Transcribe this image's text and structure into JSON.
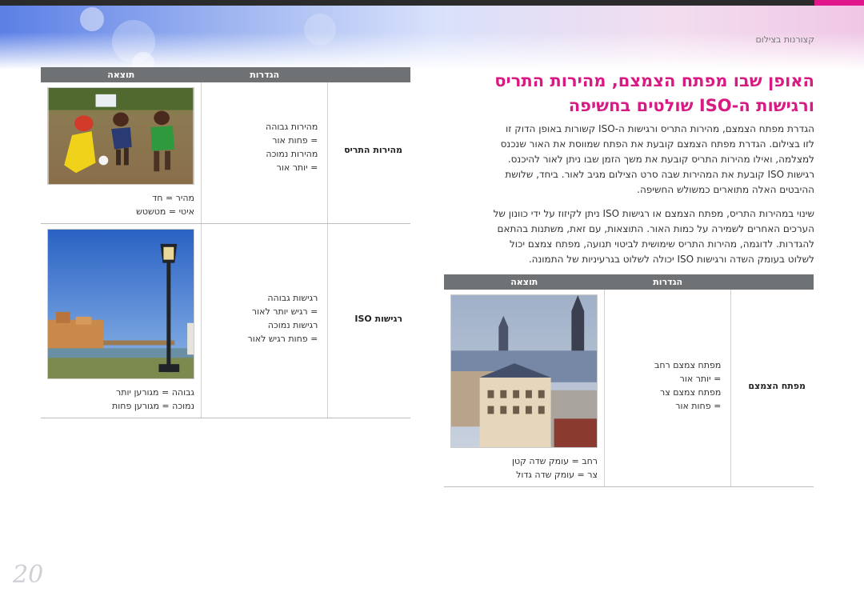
{
  "breadcrumb": "קצורנות בצילום",
  "title_line1": "האופן שבו מפתח הצמצם, מהירות התריס",
  "title_line2": "ורגישות ה-ISO שולטים בחשיפה",
  "paragraph1": [
    "הגדרת מפתח הצמצם, מהירות התריס ורגישות ה-ISO קשורות באופן הדוק זו",
    "לזו בצילום. הגדרת מפתח הצמצם קובעת את הפתח שמווסת את האור שנכנס",
    "למצלמה, ואילו מהירות התריס קובעת את משך הזמן שבו ניתן לאור להיכנס.",
    "רגישות ISO קובעת את המהירות שבה סרט הצילום מגיב לאור. ביחד, שלושת",
    "ההיבטים האלה מתוארים כמשולש החשיפה."
  ],
  "paragraph2": [
    "שינוי במהירות התריס, מפתח הצמצם או רגישות ISO ניתן לקיזוז על ידי כוונון של",
    "הערכים האחרים לשמירה על כמות האור. התוצאות, עם זאת, משתנות בהתאם",
    "להגדרות. לדוגמה, מהירות התריס שימושית לביטוי תנועה, מפתח צמצם יכול",
    "לשלוט בעומק השדה ורגישות ISO יכולה לשלוט בגרעיניות של התמונה."
  ],
  "table_headers": {
    "setting": "הגדרות",
    "result": "תוצאה"
  },
  "table_left": {
    "rows": [
      {
        "name": "מהירות התריס",
        "desc": [
          "מהירות גבוהה",
          "= פחות אור",
          "מהירות נמוכה",
          "= יותר אור"
        ],
        "effect": [
          "מהיר = חד",
          "איטי = מטשטש"
        ]
      },
      {
        "name": "רגישות ISO",
        "desc": [
          "רגישות גבוהה",
          "= רגיש יותר לאור",
          "רגישות נמוכה",
          "= פחות רגיש לאור"
        ],
        "effect": [
          "גבוהה = מגורען יותר",
          "נמוכה = מגורען פחות"
        ]
      }
    ]
  },
  "table_right": {
    "rows": [
      {
        "name": "מפתח הצמצם",
        "desc": [
          "מפתח צמצם רחב",
          "= יותר אור",
          "מפתח צמצם צר",
          "= פחות אור"
        ],
        "effect": [
          "רחב = עומק שדה קטן",
          "צר = עומק שדה גדול"
        ]
      }
    ]
  },
  "page_number": "20"
}
